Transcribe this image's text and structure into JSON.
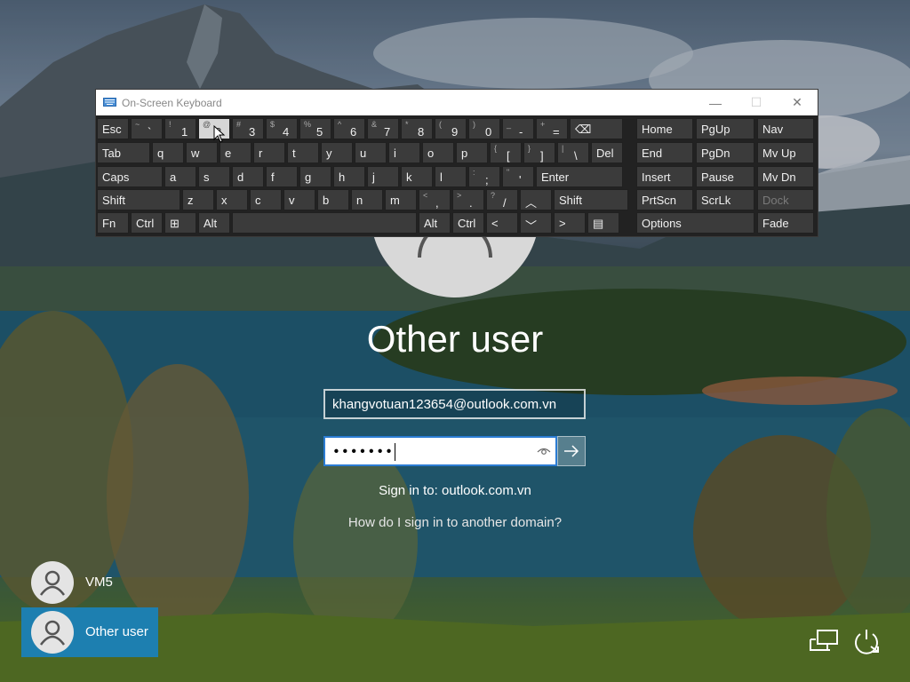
{
  "osk": {
    "title": "On-Screen Keyboard",
    "minimize": "—",
    "maximize": "☐",
    "close": "✕",
    "row1": [
      {
        "label": "Esc"
      },
      {
        "shift": "~",
        "main": "`"
      },
      {
        "shift": "!",
        "main": "1"
      },
      {
        "shift": "@",
        "main": "2"
      },
      {
        "shift": "#",
        "main": "3"
      },
      {
        "shift": "$",
        "main": "4"
      },
      {
        "shift": "%",
        "main": "5"
      },
      {
        "shift": "^",
        "main": "6"
      },
      {
        "shift": "&",
        "main": "7"
      },
      {
        "shift": "*",
        "main": "8"
      },
      {
        "shift": "(",
        "main": "9"
      },
      {
        "shift": ")",
        "main": "0"
      },
      {
        "shift": "_",
        "main": "-"
      },
      {
        "shift": "+",
        "main": "="
      },
      {
        "label": "⌫"
      }
    ],
    "row2": [
      {
        "label": "Tab"
      },
      {
        "label": "q"
      },
      {
        "label": "w"
      },
      {
        "label": "e"
      },
      {
        "label": "r"
      },
      {
        "label": "t"
      },
      {
        "label": "y"
      },
      {
        "label": "u"
      },
      {
        "label": "i"
      },
      {
        "label": "o"
      },
      {
        "label": "p"
      },
      {
        "shift": "{",
        "main": "["
      },
      {
        "shift": "}",
        "main": "]"
      },
      {
        "shift": "|",
        "main": "\\"
      },
      {
        "label": "Del"
      }
    ],
    "row3": [
      {
        "label": "Caps"
      },
      {
        "label": "a"
      },
      {
        "label": "s"
      },
      {
        "label": "d"
      },
      {
        "label": "f"
      },
      {
        "label": "g"
      },
      {
        "label": "h"
      },
      {
        "label": "j"
      },
      {
        "label": "k"
      },
      {
        "label": "l"
      },
      {
        "shift": ":",
        "main": ";"
      },
      {
        "shift": "\"",
        "main": "'"
      },
      {
        "label": "Enter"
      }
    ],
    "row4": [
      {
        "label": "Shift"
      },
      {
        "label": "z"
      },
      {
        "label": "x"
      },
      {
        "label": "c"
      },
      {
        "label": "v"
      },
      {
        "label": "b"
      },
      {
        "label": "n"
      },
      {
        "label": "m"
      },
      {
        "shift": "<",
        "main": ","
      },
      {
        "shift": ">",
        "main": "."
      },
      {
        "shift": "?",
        "main": "/"
      },
      {
        "label": "︿"
      },
      {
        "label": "Shift"
      }
    ],
    "row5": [
      {
        "label": "Fn"
      },
      {
        "label": "Ctrl"
      },
      {
        "label": "⊞"
      },
      {
        "label": "Alt"
      },
      {
        "label": ""
      },
      {
        "label": "Alt"
      },
      {
        "label": "Ctrl"
      },
      {
        "label": "<"
      },
      {
        "label": "﹀"
      },
      {
        "label": ">"
      },
      {
        "label": "▤"
      }
    ],
    "nav": [
      [
        "Home",
        "PgUp",
        "Nav"
      ],
      [
        "End",
        "PgDn",
        "Mv Up"
      ],
      [
        "Insert",
        "Pause",
        "Mv Dn"
      ],
      [
        "PrtScn",
        "ScrLk",
        "Dock"
      ],
      [
        "Options",
        "Fade"
      ]
    ]
  },
  "login": {
    "user_title": "Other user",
    "email_value": "khangvotuan123654@outlook.com.vn",
    "password_mask": "•••••••",
    "signin_to": "Sign in to: outlook.com.vn",
    "other_domain_link": "How do I sign in to another domain?"
  },
  "users": [
    {
      "name": "VM5"
    },
    {
      "name": "Other user"
    }
  ],
  "colors": {
    "selected_tile": "#1d7fb0",
    "password_border": "#2b7cd3"
  },
  "icons": {
    "network": "network-icon",
    "power": "power-icon",
    "submit": "arrow-right-icon",
    "reveal": "eye-icon"
  }
}
